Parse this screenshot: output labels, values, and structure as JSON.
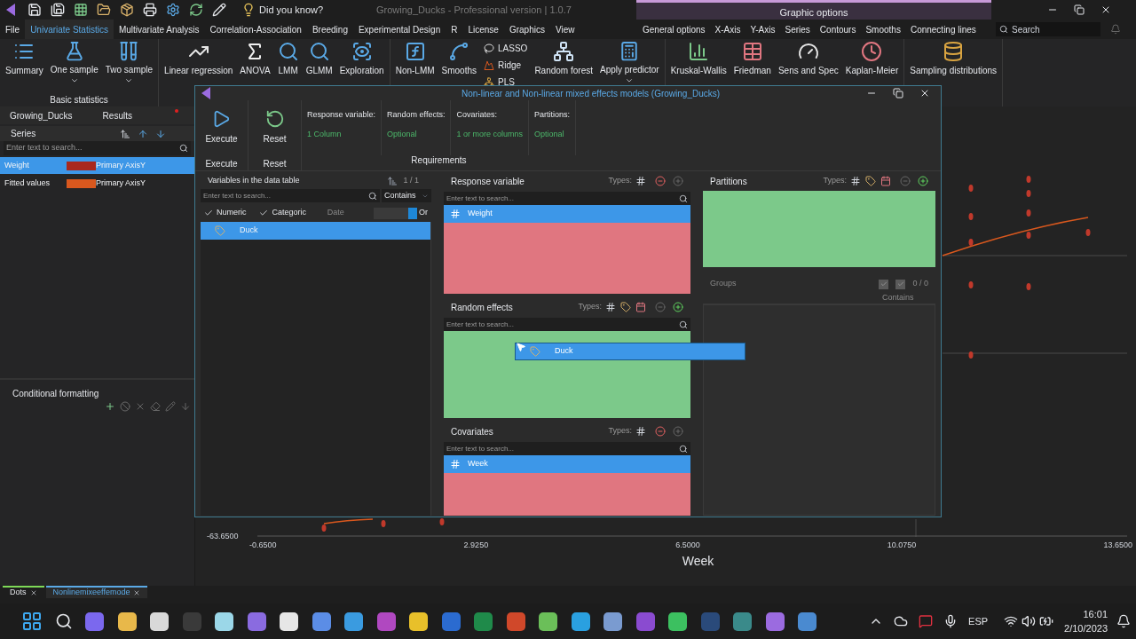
{
  "title_bar": {
    "tip": "Did you know?",
    "title": "Growing_Ducks - Professional version | 1.0.7"
  },
  "menu": [
    {
      "label": "File",
      "selected": false
    },
    {
      "label": "Univariate Statistics",
      "selected": true
    },
    {
      "label": "Multivariate Analysis",
      "selected": false
    },
    {
      "label": "Correlation-Association",
      "selected": false
    },
    {
      "label": "Breeding",
      "selected": false
    },
    {
      "label": "Experimental Design",
      "selected": false
    },
    {
      "label": "R",
      "selected": false
    },
    {
      "label": "License",
      "selected": false
    },
    {
      "label": "Graphics",
      "selected": false
    },
    {
      "label": "View",
      "selected": false
    }
  ],
  "graphic_options": {
    "title": "Graphic options",
    "tabs": [
      "General options",
      "X-Axis",
      "Y-Axis",
      "Series",
      "Contours",
      "Smooths",
      "Connecting lines"
    ],
    "search": {
      "placeholder": "Search"
    }
  },
  "ribbon": {
    "groups": [
      {
        "label": "Basic statistics",
        "buttons": [
          {
            "label": "Summary",
            "kind": "large",
            "dropdown": false
          },
          {
            "label": "One sample",
            "kind": "large",
            "dropdown": true
          },
          {
            "label": "Two sample",
            "kind": "large",
            "dropdown": true
          }
        ]
      },
      {
        "buttons": [
          {
            "label": "Linear regression",
            "kind": "large",
            "dropdown": false
          },
          {
            "label": "ANOVA",
            "kind": "large",
            "dropdown": false
          },
          {
            "label": "LMM",
            "kind": "large",
            "dropdown": false
          },
          {
            "label": "GLMM",
            "kind": "large",
            "dropdown": false
          },
          {
            "label": "Exploration",
            "kind": "large",
            "dropdown": false
          }
        ]
      },
      {
        "buttons": [
          {
            "label": "Non-LMM",
            "kind": "large",
            "dropdown": false
          },
          {
            "label": "Smooths",
            "kind": "large",
            "dropdown": false
          },
          {
            "label": "LASSO",
            "kind": "small",
            "dropdown": false
          },
          {
            "label": "Ridge",
            "kind": "small",
            "dropdown": false
          },
          {
            "label": "PLS",
            "kind": "small",
            "dropdown": false
          },
          {
            "label": "Random forest",
            "kind": "large",
            "dropdown": false
          },
          {
            "label": "Apply predictor",
            "kind": "large",
            "dropdown": true
          }
        ]
      },
      {
        "buttons": [
          {
            "label": "Kruskal-Wallis",
            "kind": "large",
            "dropdown": false
          },
          {
            "label": "Friedman",
            "kind": "large",
            "dropdown": false
          },
          {
            "label": "Sens and Spec",
            "kind": "large",
            "dropdown": false
          },
          {
            "label": "Kaplan-Meier",
            "kind": "large",
            "dropdown": false
          }
        ]
      },
      {
        "buttons": [
          {
            "label": "Sampling distributions",
            "kind": "large",
            "dropdown": false
          }
        ]
      }
    ]
  },
  "left_panel": {
    "tabs": [
      {
        "label": "Growing_Ducks",
        "flagged": false
      },
      {
        "label": "Results",
        "flagged": true
      }
    ],
    "series": {
      "title": "Series",
      "search": {
        "placeholder": "Enter text to search..."
      },
      "rows": [
        {
          "name": "Weight",
          "color": "#a8281e",
          "axis": "Primary AxisY",
          "selected": true
        },
        {
          "name": "Fitted values",
          "color": "#d9581e",
          "axis": "Primary AxisY",
          "selected": false
        }
      ]
    },
    "conditional_formatting": {
      "title": "Conditional formatting"
    }
  },
  "chart": {
    "y_tick": "-63.6500",
    "x_ticks": [
      "-0.6500",
      "2.9250",
      "6.5000",
      "10.0750",
      "13.6500"
    ],
    "xlabel": "Week"
  },
  "bottom_tabs": [
    {
      "label": "Dots",
      "selected": false,
      "color": "#7ed957"
    },
    {
      "label": "Nonlinemixeeffemode",
      "selected": true,
      "color": "#5aa9e6"
    }
  ],
  "dialog": {
    "title": "Non-linear and Non-linear mixed effects models (Growing_Ducks)",
    "actions": [
      {
        "label": "Execute",
        "group": "Execute"
      },
      {
        "label": "Reset",
        "group": "Reset"
      }
    ],
    "requirements_label": "Requirements",
    "requirements": [
      {
        "label": "Response variable:",
        "value": "1 Column"
      },
      {
        "label": "Random effects:",
        "value": "Optional"
      },
      {
        "label": "Covariates:",
        "value": "1 or more columns"
      },
      {
        "label": "Partitions:",
        "value": "Optional"
      }
    ],
    "variables": {
      "title": "Variables in the data table",
      "counter": "1 / 1",
      "search": {
        "placeholder": "Enter text to search..."
      },
      "match": "Contains",
      "filters": [
        {
          "label": "Numeric",
          "checked": true,
          "disabled": false
        },
        {
          "label": "Categoric",
          "checked": true,
          "disabled": false
        },
        {
          "label": "Date",
          "checked": false,
          "disabled": true
        }
      ],
      "mode_on": true,
      "mode": "Or",
      "items": [
        {
          "name": "Duck",
          "kind": "categoric",
          "selected": true
        }
      ]
    },
    "slots": [
      {
        "title": "Response variable",
        "types_label": "Types:",
        "types": [
          {
            "kind": "numeric"
          }
        ],
        "can_remove": true,
        "can_add": false,
        "search": {
          "placeholder": "Enter text to search..."
        },
        "color": "#e07680",
        "items": [
          {
            "name": "Weight",
            "kind": "numeric"
          }
        ]
      },
      {
        "title": "Random effects",
        "types_label": "Types:",
        "types": [
          {
            "kind": "numeric"
          },
          {
            "kind": "categoric"
          },
          {
            "kind": "date"
          }
        ],
        "can_remove": false,
        "can_add": true,
        "search": {
          "placeholder": "Enter text to search..."
        },
        "color": "#7cc98a"
      },
      {
        "title": "Covariates",
        "types_label": "Types:",
        "types": [
          {
            "kind": "numeric"
          }
        ],
        "can_remove": true,
        "can_add": false,
        "search": {
          "placeholder": "Enter text to search..."
        },
        "color": "#e07680",
        "items": [
          {
            "name": "Week",
            "kind": "numeric"
          }
        ]
      }
    ],
    "partitions": {
      "title": "Partitions",
      "types_label": "Types:",
      "types": [
        {
          "kind": "numeric"
        },
        {
          "kind": "categoric"
        },
        {
          "kind": "date"
        }
      ],
      "can_remove": false,
      "can_add": true,
      "color": "#7cc98a"
    },
    "groups": {
      "title": "Groups",
      "checkboxes": [
        {
          "checked": true
        },
        {
          "checked": true
        }
      ],
      "counter": "0 / 0",
      "match": "Contains"
    },
    "drag_item": {
      "name": "Duck",
      "kind": "categoric"
    }
  },
  "taskbar": {
    "language": "ESP",
    "time": "16:01",
    "date": "2/10/2023"
  }
}
